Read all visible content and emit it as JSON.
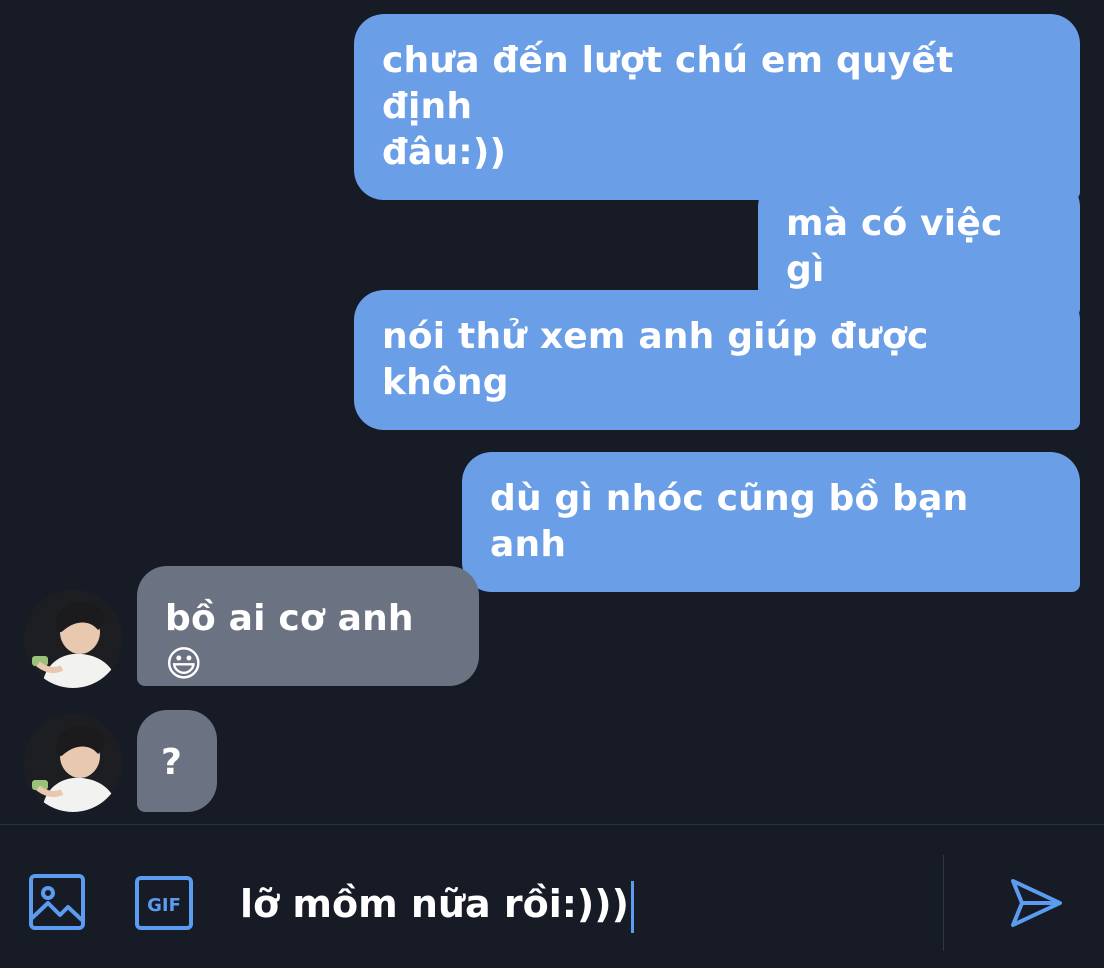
{
  "conversation": {
    "outgoing_messages": [
      {
        "text_line1": "chưa đến lượt chú em quyết định",
        "text_line2": "đâu:))"
      },
      {
        "text_line1": "mà có việc gì"
      },
      {
        "text_line1": "nói thử xem anh giúp được",
        "text_line2": "không"
      },
      {
        "text_line1": "dù gì nhóc cũng bồ bạn anh"
      }
    ],
    "incoming_messages": [
      {
        "text": "bồ ai cơ anh😃"
      },
      {
        "text": "?"
      }
    ]
  },
  "composer": {
    "input_value": "lỡ mồm nữa rồi:)))",
    "gif_label": "GIF",
    "icons": [
      "image-icon",
      "gif-icon",
      "send-icon"
    ]
  },
  "colors": {
    "background": "#161b26",
    "outgoing_bubble": "#6a9ee6",
    "incoming_bubble": "#6b7282",
    "accent": "#5b9bf0"
  }
}
